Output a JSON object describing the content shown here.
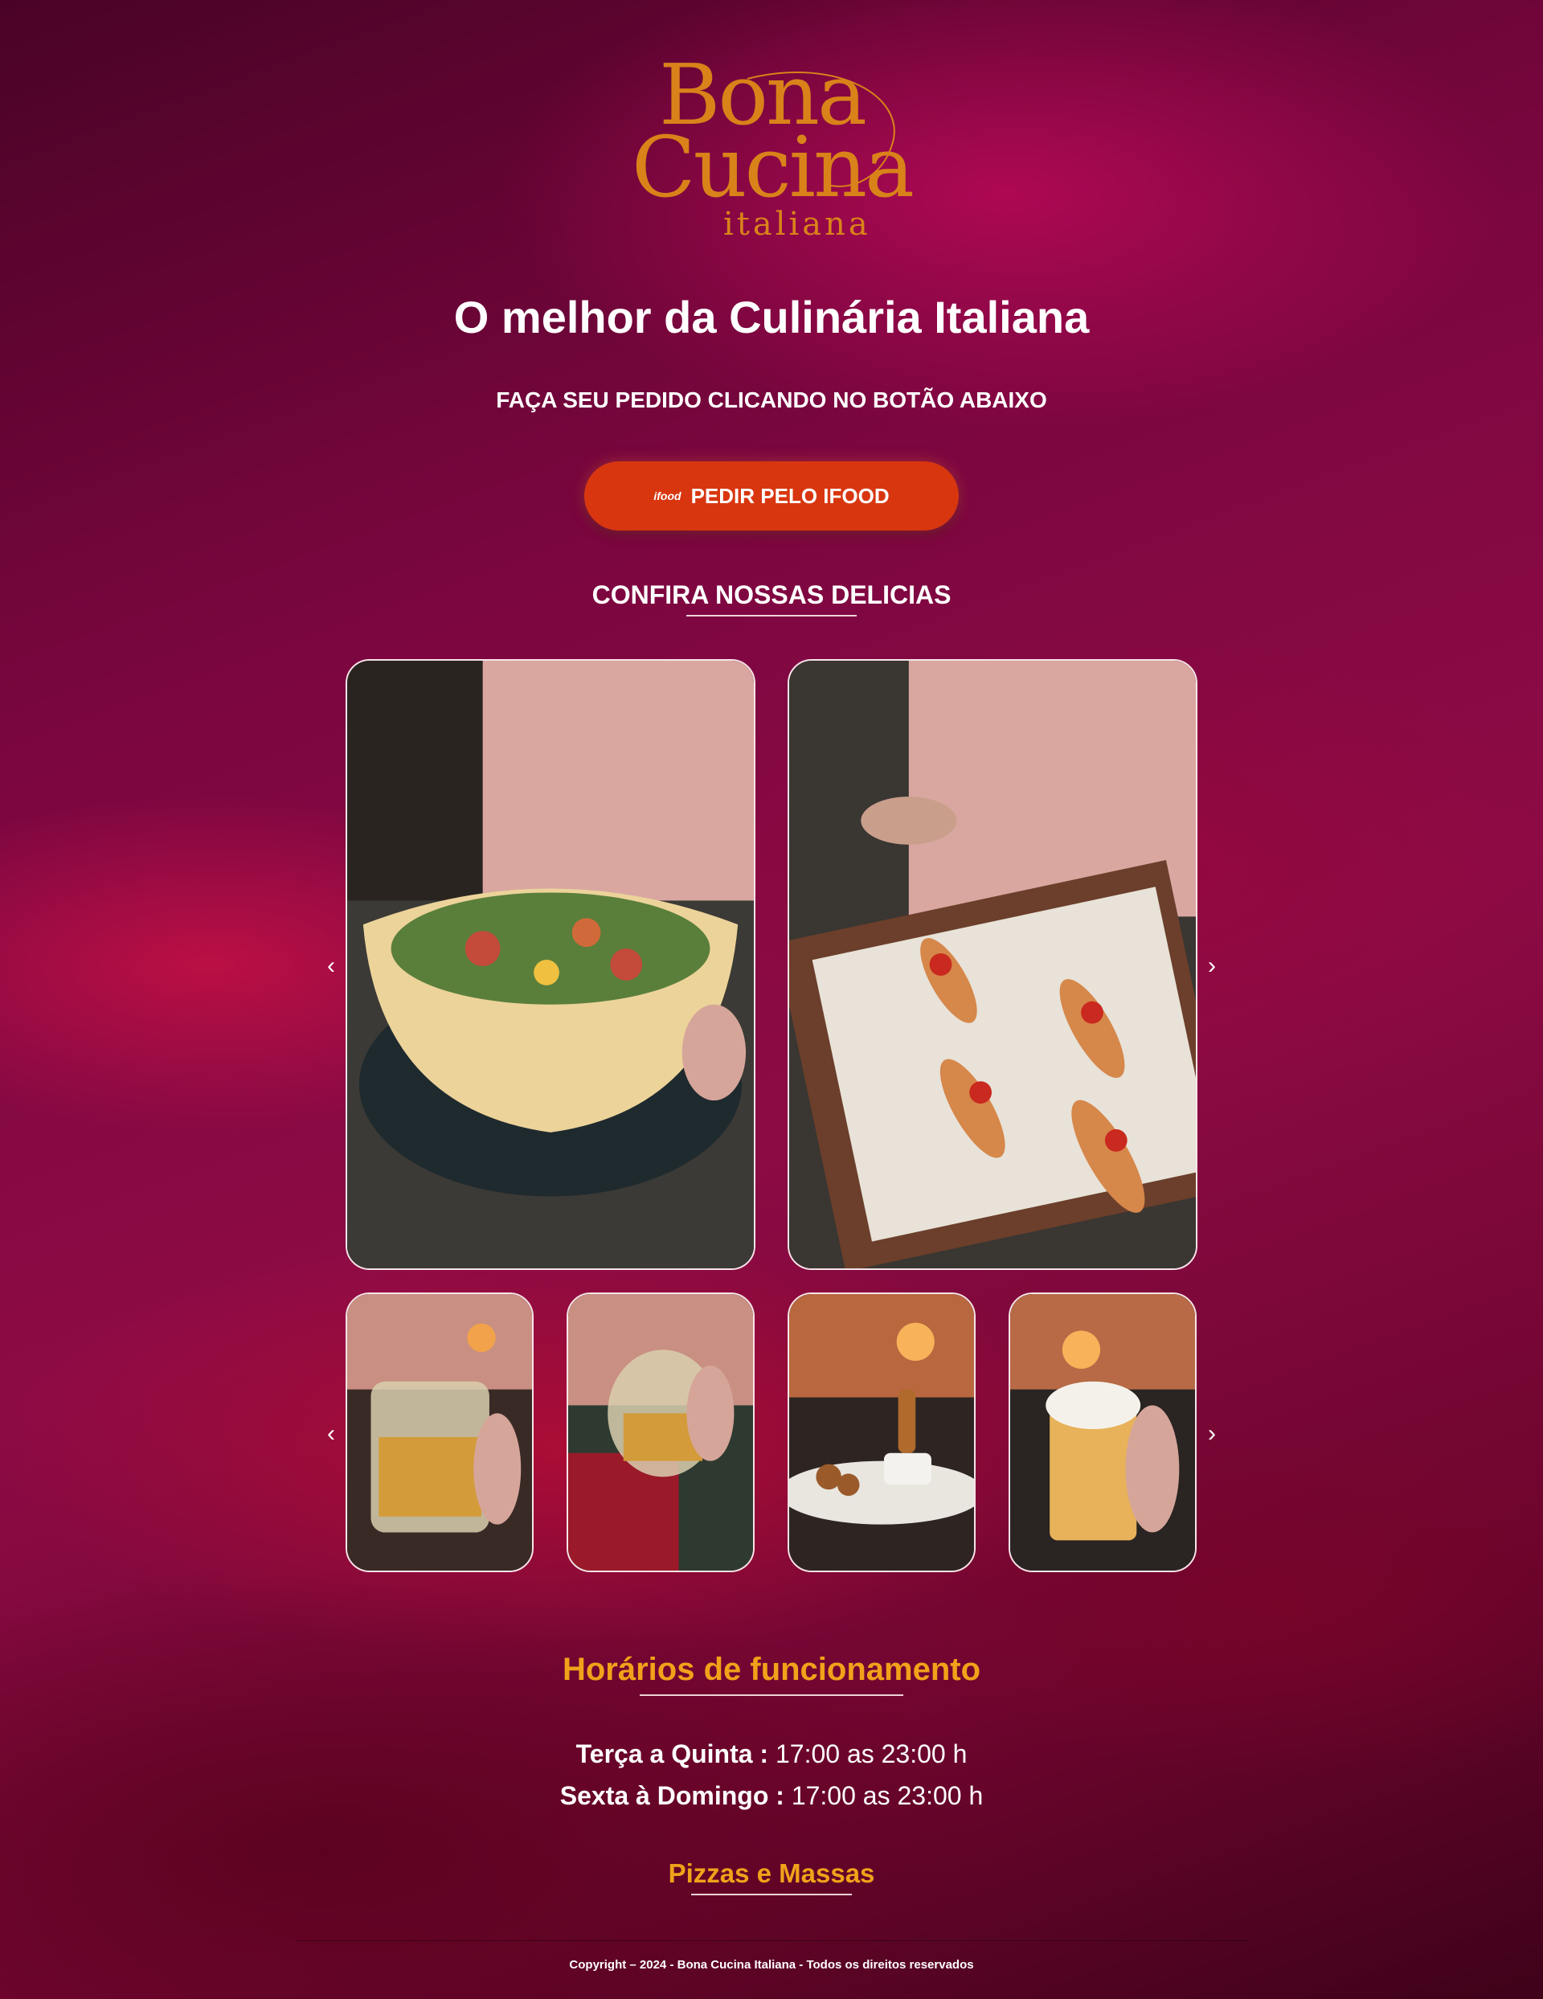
{
  "logo": {
    "line1": "Bona",
    "line2": "Cucina",
    "line3": "italiana"
  },
  "hero": {
    "title": "O melhor da Culinária Italiana",
    "subtitle": "FAÇA SEU PEDIDO CLICANDO NO BOTÃO ABAIXO",
    "cta_icon_text": "ifood",
    "cta_label": "PEDIR PELO IFOOD"
  },
  "gallery": {
    "heading": "CONFIRA NOSSAS DELICIAS",
    "prev_arrow": "‹",
    "next_arrow": "›"
  },
  "hours": {
    "heading": "Horários de funcionamento",
    "rows": [
      {
        "days": "Terça a Quinta :",
        "time": "17:00 as 23:00 h"
      },
      {
        "days": "Sexta à Domingo :",
        "time": "17:00 as 23:00 h"
      }
    ]
  },
  "menu_link": "Pizzas e Massas",
  "footer": {
    "copyright": "Copyright – 2024 - Bona Cucina Italiana - Todos os direitos reservados"
  },
  "colors": {
    "accent": "#f0a21a",
    "cta": "#d8360f",
    "logo": "#d9821a"
  }
}
